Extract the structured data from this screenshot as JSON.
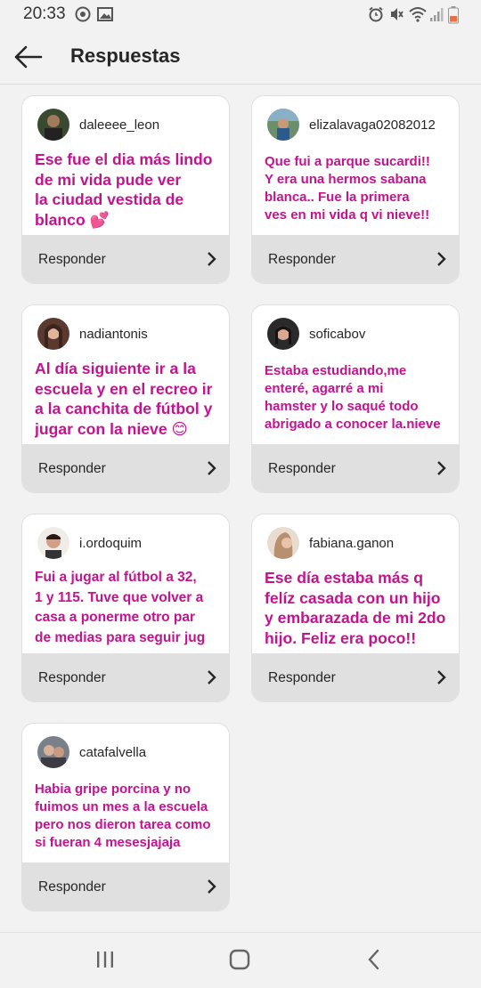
{
  "status_bar": {
    "time": "20:33",
    "left_icons": [
      "sync-badge-icon",
      "gallery-icon"
    ],
    "right_icons": [
      "alarm-icon",
      "mute-icon",
      "wifi-icon",
      "signal-icon",
      "battery-icon"
    ],
    "battery_color": "#e8733f"
  },
  "header": {
    "title": "Respuestas"
  },
  "accent_color": "#c2148d",
  "cards": [
    {
      "username": "daleeee_leon",
      "text": "Ese fue el dia más lindo\nde mi vida pude ver\nla ciudad vestida de\nblanco 💕",
      "size": "big",
      "reply_label": "Responder"
    },
    {
      "username": "elizalavaga02082012",
      "text": "Que fui a parque sucardi!!\nY era una hermos sabana\nblanca.. Fue la primera\nves en mi vida q vi nieve!!",
      "size": "small",
      "reply_label": "Responder"
    },
    {
      "username": "nadiantonis",
      "text": "Al día siguiente ir a la\nescuela y en el recreo ir\na la canchita de fútbol y\njugar con la nieve 😊",
      "size": "big",
      "reply_label": "Responder"
    },
    {
      "username": "soficabov",
      "text": "Estaba estudiando,me\nenteré,  agarré a mi\nhamster y lo saqué todo\nabrigado a conocer la.nieve",
      "size": "small",
      "reply_label": "Responder"
    },
    {
      "username": "i.ordoquim",
      "text": "Fui a jugar al fútbol a 32,\n1 y 115. Tuve que volver a\ncasa a ponerme otro par\nde medias para seguir jug",
      "size": "small",
      "reply_label": "Responder"
    },
    {
      "username": "fabiana.ganon",
      "text": "Ese día estaba más q\nfelíz casada con un hijo\ny embarazada de mi 2do\nhijo. Feliz era poco!!",
      "size": "big",
      "reply_label": "Responder"
    },
    {
      "username": "catafalvella",
      "text": "Habia gripe porcina y no\nfuimos un mes a la escuela\npero nos dieron tarea como\nsi fueran 4 mesesjajaja",
      "size": "small",
      "reply_label": "Responder"
    }
  ],
  "nav_bar": {
    "buttons": [
      "recent-apps-icon",
      "home-icon",
      "back-icon"
    ]
  }
}
